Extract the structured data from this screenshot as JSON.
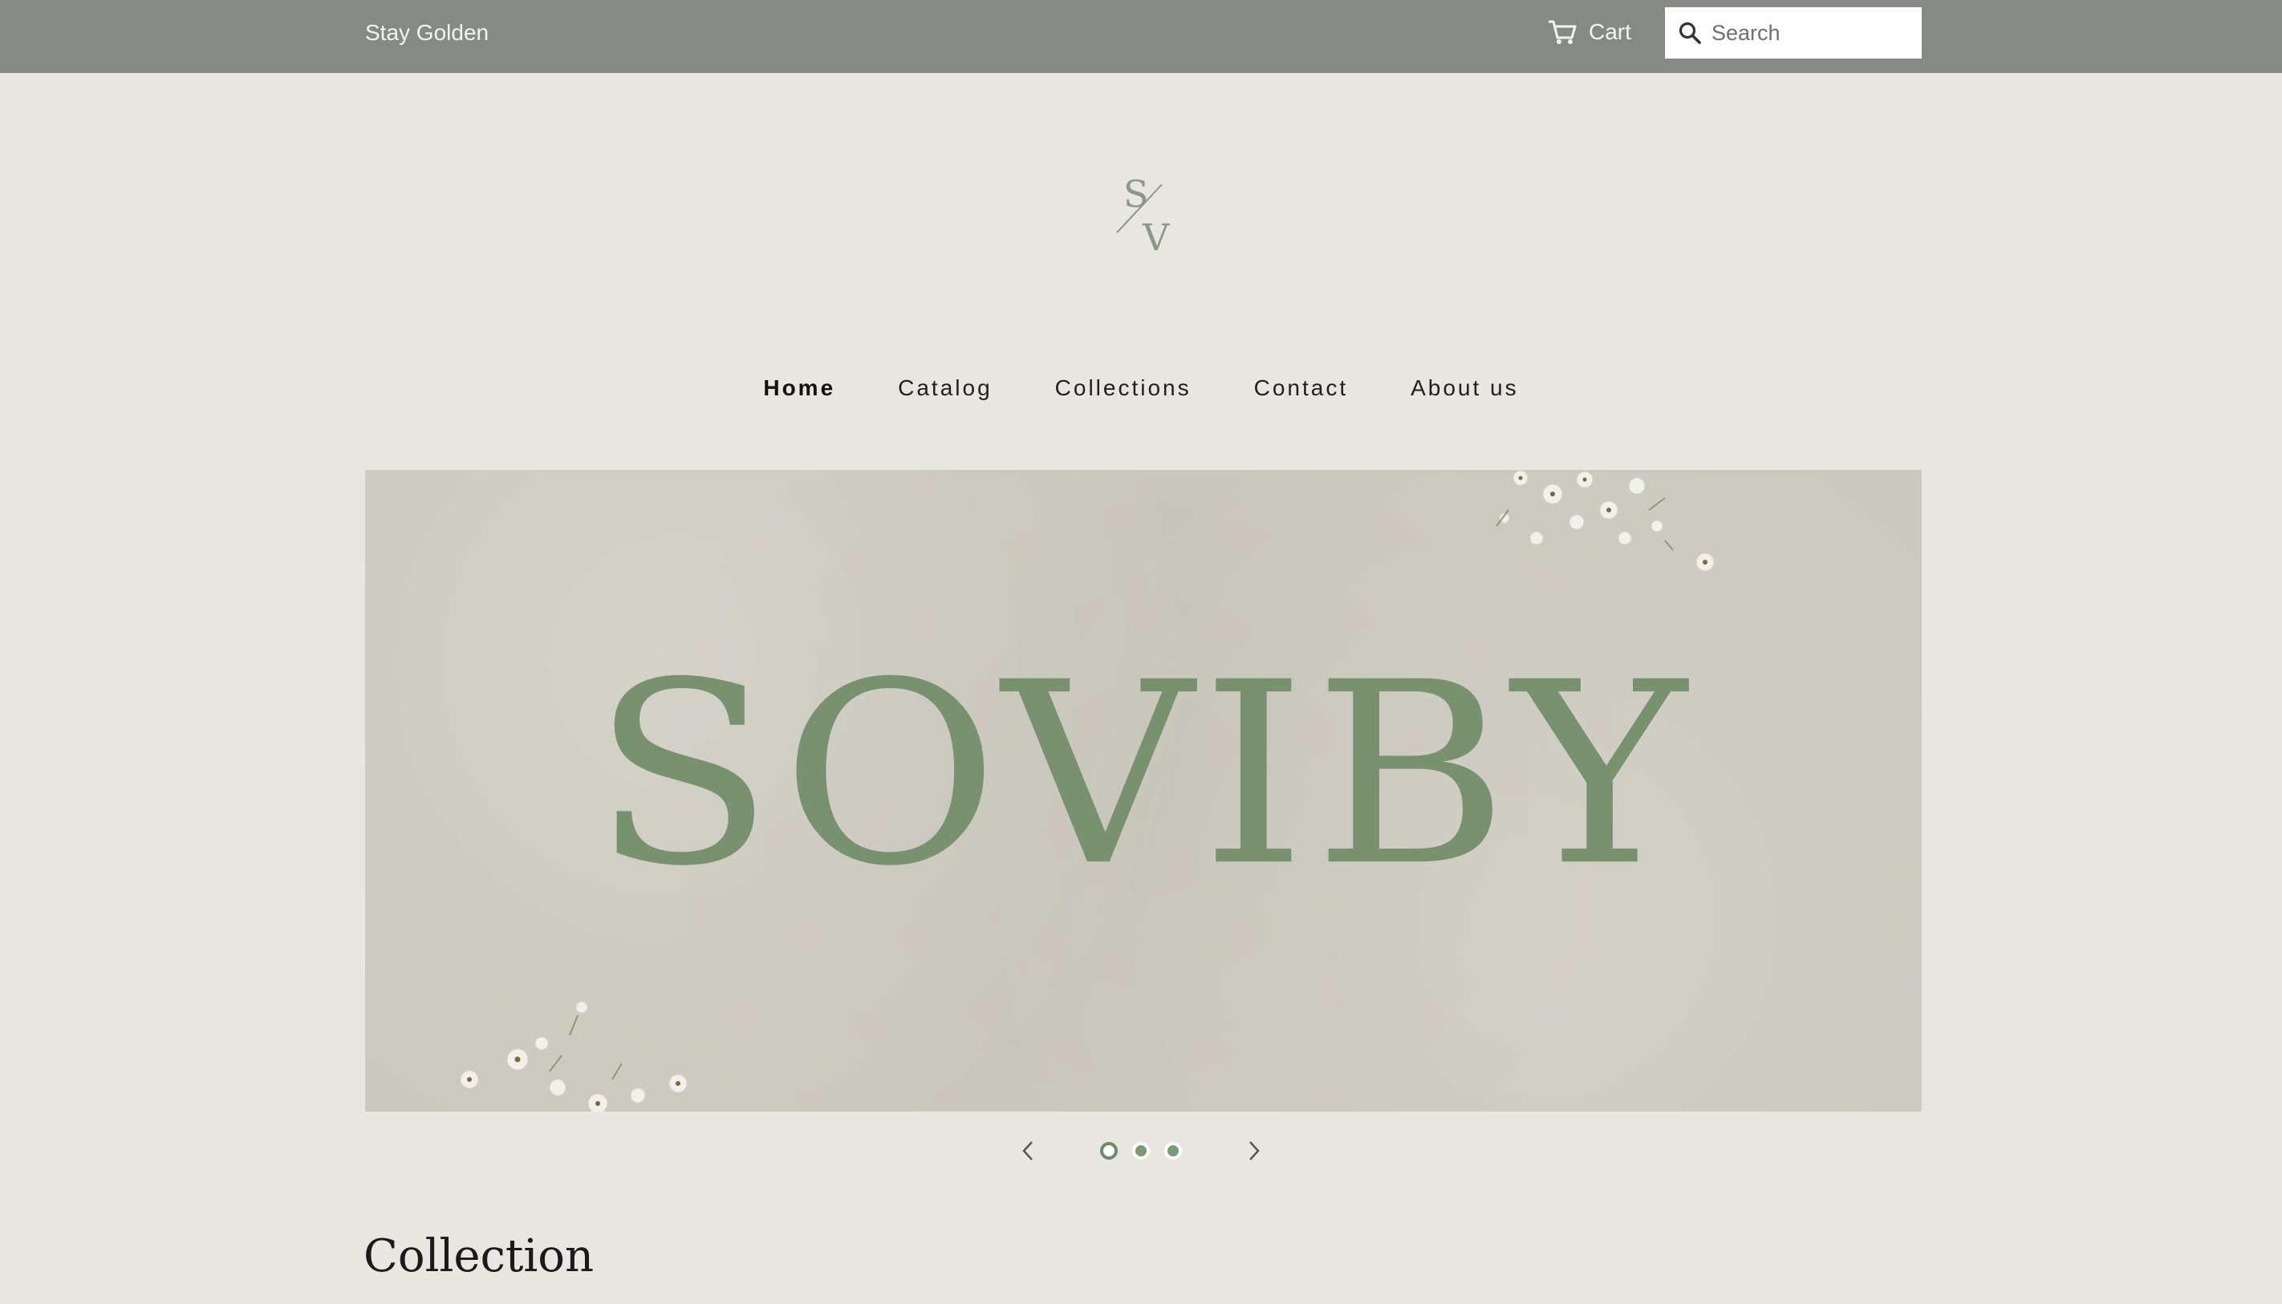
{
  "topbar": {
    "tagline": "Stay Golden",
    "cart_label": "Cart",
    "search_placeholder": "Search"
  },
  "logo": {
    "top_letter": "S",
    "bottom_letter": "V"
  },
  "nav": {
    "items": [
      {
        "label": "Home",
        "active": true
      },
      {
        "label": "Catalog",
        "active": false
      },
      {
        "label": "Collections",
        "active": false
      },
      {
        "label": "Contact",
        "active": false
      },
      {
        "label": "About us",
        "active": false
      }
    ]
  },
  "hero": {
    "brand_text": "SOVIBY",
    "slide_count": 3,
    "active_slide": 1
  },
  "section": {
    "title": "Collection"
  },
  "colors": {
    "topbar": "#878a84",
    "background": "#e7e6e1",
    "brand_green": "#789270",
    "hero_bg": "#cbc8be"
  },
  "icons": [
    "cart-icon",
    "search-icon",
    "chevron-left-icon",
    "chevron-right-icon"
  ]
}
